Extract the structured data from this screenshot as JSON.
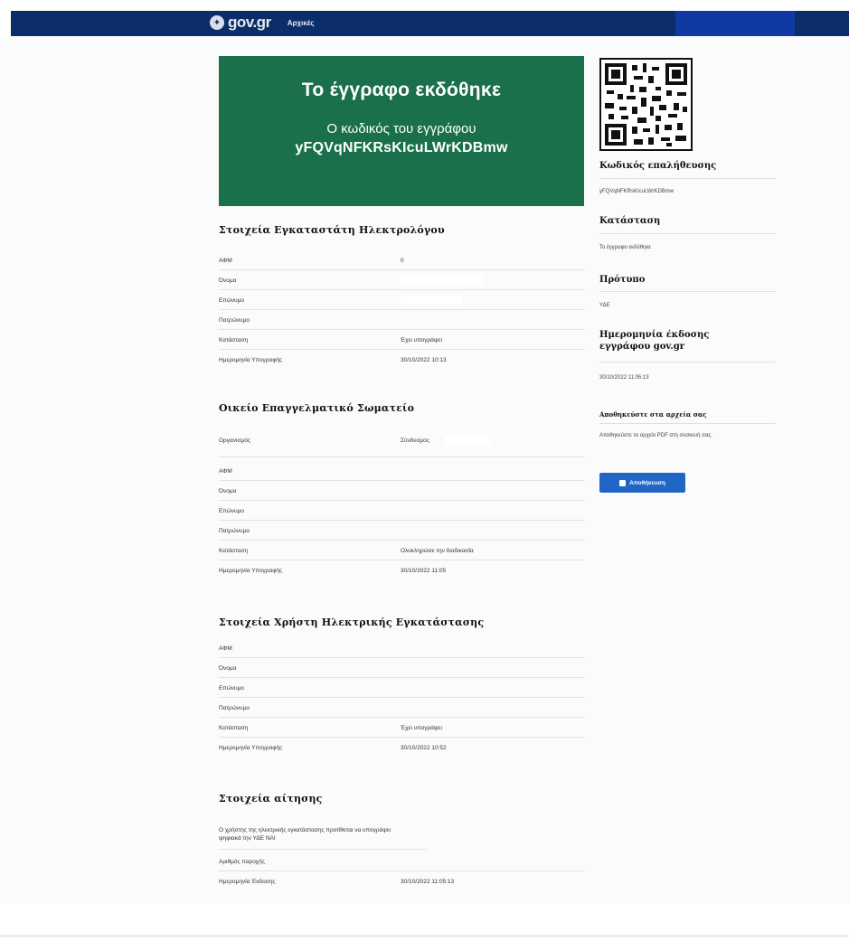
{
  "header": {
    "brand": "gov.gr",
    "logo_emblem": "✦",
    "subtitle": "Αρχικές"
  },
  "banner": {
    "title": "Το έγγραφο εκδόθηκε",
    "subtitle": "Ο κωδικός του εγγράφου",
    "code": "yFQVqNFKRsKIcuLWrKDBmw"
  },
  "sections": [
    {
      "title": "Στοιχεία Εγκαταστάτη Ηλεκτρολόγου",
      "rows": [
        {
          "label": "ΑΦΜ",
          "value": "0"
        },
        {
          "label": "Όνομα",
          "value": ""
        },
        {
          "label": "Επώνυμο",
          "value": ""
        },
        {
          "label": "Πατρώνυμο",
          "value": ""
        },
        {
          "label": "Κατάσταση",
          "value": "Έχει υπογράψει"
        },
        {
          "label": "Ημερομηνία Υπογραφής",
          "value": "30/10/2022 10:13"
        }
      ]
    },
    {
      "title": "Οικείο Επαγγελματικό Σωματείο",
      "rows": [
        {
          "label": "Οργανισμός",
          "value": "Σύνδεσμος"
        },
        {
          "label": "ΑΦΜ",
          "value": ""
        },
        {
          "label": "Όνομα",
          "value": ""
        },
        {
          "label": "Επώνυμο",
          "value": ""
        },
        {
          "label": "Πατρώνυμο",
          "value": ""
        },
        {
          "label": "Κατάσταση",
          "value": "Ολοκληρώσε την διαδικασία"
        },
        {
          "label": "Ημερομηνία Υπογραφής",
          "value": "30/10/2022 11:05"
        }
      ]
    },
    {
      "title": "Στοιχεία Χρήστη Ηλεκτρικής Εγκατάστασης",
      "rows": [
        {
          "label": "ΑΦΜ",
          "value": ""
        },
        {
          "label": "Όνομα",
          "value": ""
        },
        {
          "label": "Επώνυμο",
          "value": ""
        },
        {
          "label": "Πατρώνυμο",
          "value": ""
        },
        {
          "label": "Κατάσταση",
          "value": "Έχει υπογράψει"
        },
        {
          "label": "Ημερομηνία Υπογραφής",
          "value": "30/10/2022 10:52"
        }
      ]
    },
    {
      "title": "Στοιχεία αίτησης",
      "rows": [
        {
          "label": "Ο χρήστης της ηλεκτρικής εγκατάστασης προτίθεται να υπογράψει ψηφιακά την ΥΔΕ ΝΑΙ",
          "value": ""
        },
        {
          "label": "Αριθμός παροχής",
          "value": ""
        },
        {
          "label": "Ημερομηνία Έκδοσης",
          "value": "30/10/2022 11:05:13"
        }
      ]
    }
  ],
  "sidebar": {
    "verification_title": "Κωδικός επαλήθευσης",
    "verification_code": "yFQVqNFKRsKIcuLWrKDBmw",
    "status_title": "Κατάσταση",
    "status_value": "Το έγγραφο εκδόθηκε",
    "template_title": "Πρότυπο",
    "template_value": "ΥΔΕ",
    "issue_date_title": "Ημερομηνία έκδοσης εγγράφου gov.gr",
    "issue_date_value": "30/10/2022 11:05:13",
    "save_title": "Αποθηκεύστε στα αρχεία σας",
    "save_text": "Αποθηκεύστε το αρχείο PDF στη συσκευή σας.",
    "save_button": "Αποθήκευση"
  },
  "colors": {
    "header": "#0b2e6b",
    "banner": "#19704a",
    "button": "#1f66c7"
  }
}
